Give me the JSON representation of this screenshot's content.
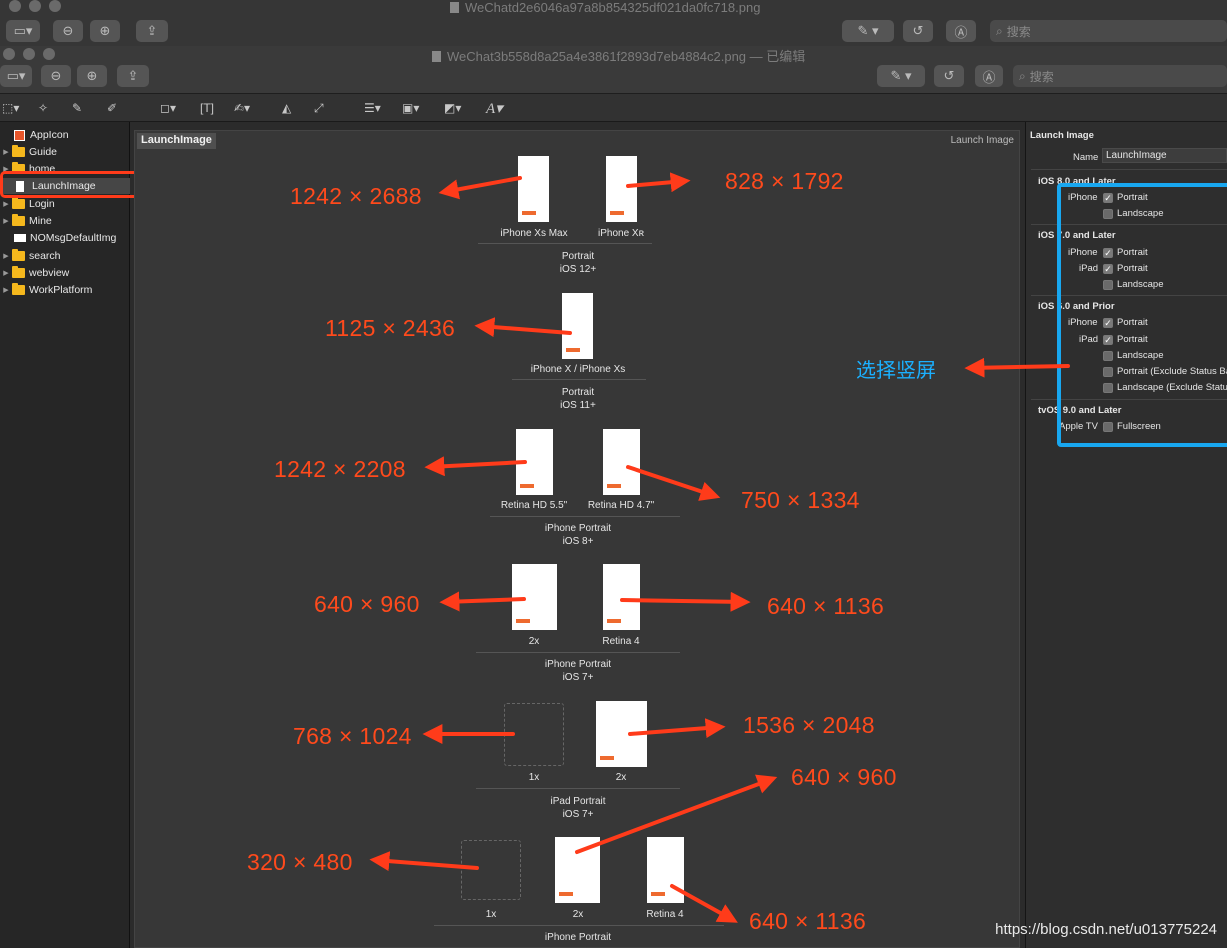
{
  "window1": {
    "title": "WeChatd2e6046a97a8b854325df021da0fc718.png",
    "search_placeholder": "搜索"
  },
  "window2": {
    "title": "WeChat3b558d8a25a4e3861f2893d7eb4884c2.png — 已编辑",
    "search_placeholder": "搜索"
  },
  "sidebar": {
    "items": [
      {
        "label": "AppIcon",
        "kind": "appicon"
      },
      {
        "label": "Guide",
        "kind": "folder"
      },
      {
        "label": "home",
        "kind": "folder"
      },
      {
        "label": "LaunchImage",
        "kind": "imageset",
        "selected": true
      },
      {
        "label": "Login",
        "kind": "folder"
      },
      {
        "label": "Mine",
        "kind": "folder"
      },
      {
        "label": "NOMsgDefaultImg",
        "kind": "imageset-wide"
      },
      {
        "label": "search",
        "kind": "folder"
      },
      {
        "label": "webview",
        "kind": "folder"
      },
      {
        "label": "WorkPlatform",
        "kind": "folder"
      }
    ]
  },
  "canvas": {
    "tab_label": "LaunchImage",
    "header_right": "Launch Image",
    "slots": {
      "xs_max": "iPhone Xs Max",
      "xr": "iPhone Xʀ",
      "x_xs": "iPhone X / iPhone Xs",
      "hd55": "Retina HD 5.5\"",
      "hd47": "Retina HD 4.7\"",
      "ios7_2x": "2x",
      "ios7_r4": "Retina 4",
      "ipad_1x": "1x",
      "ipad_2x": "2x",
      "old_1x": "1x",
      "old_2x": "2x",
      "old_r4": "Retina 4"
    },
    "groups": {
      "g1_l1": "Portrait",
      "g1_l2": "iOS 12+",
      "g2_l1": "Portrait",
      "g2_l2": "iOS 11+",
      "g3_l1": "iPhone Portrait",
      "g3_l2": "iOS 8+",
      "g4_l1": "iPhone Portrait",
      "g4_l2": "iOS 7+",
      "g5_l1": "iPad Portrait",
      "g5_l2": "iOS 7+",
      "g6_l1": "iPhone Portrait"
    }
  },
  "annotations": {
    "a1": "1242 × 2688",
    "a2": "828 × 1792",
    "a3": "1125 × 2436",
    "a4": "1242 × 2208",
    "a5": "750 × 1334",
    "a6": "640 × 960",
    "a7": "640 × 1136",
    "a8": "768 × 1024",
    "a9": "1536 × 2048",
    "a10": "640 × 960",
    "a11": "320 × 480",
    "a12": "640 × 1136",
    "select_portrait": "选择竖屏",
    "arrow_color": "#ff3b1a",
    "box_color": "#18a7f0"
  },
  "inspector": {
    "section_title": "Launch Image",
    "name_label": "Name",
    "name_value": "LaunchImage",
    "ios8_title": "iOS 8.0 and Later",
    "ios7_title": "iOS 7.0 and Later",
    "ios6_title": "iOS 6.0 and Prior",
    "tvos_title": "tvOS 9.0 and Later",
    "iphone": "iPhone",
    "ipad": "iPad",
    "apple_tv": "Apple TV",
    "portrait": "Portrait",
    "landscape": "Landscape",
    "portrait_excl": "Portrait (Exclude Status Bar)",
    "landscape_excl": "Landscape (Exclude Status Bar)",
    "fullscreen": "Fullscreen"
  },
  "watermark": "https://blog.csdn.net/u013775224"
}
